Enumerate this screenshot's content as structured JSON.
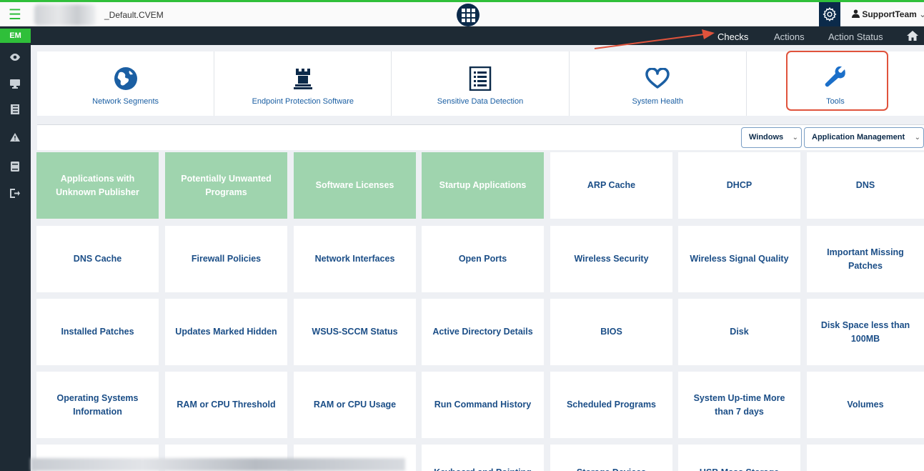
{
  "header": {
    "env_name": "_Default.CVEM",
    "user": "SupportTeam"
  },
  "sidebar": {
    "badge": "EM",
    "icons": [
      "eye-icon",
      "monitor-icon",
      "list-icon",
      "warning-icon",
      "book-icon",
      "logout-icon"
    ]
  },
  "nav": {
    "links": [
      "Checks",
      "Actions",
      "Action Status"
    ],
    "active": "Checks"
  },
  "categories": [
    {
      "label": "Network Segments",
      "icon": "globe-icon"
    },
    {
      "label": "Endpoint Protection Software",
      "icon": "rook-icon"
    },
    {
      "label": "Sensitive Data Detection",
      "icon": "document-list-icon"
    },
    {
      "label": "System Health",
      "icon": "heart-icon"
    },
    {
      "label": "Tools",
      "icon": "wrench-icon"
    }
  ],
  "filters": {
    "os": "Windows",
    "group": "Application Management"
  },
  "tiles": [
    "Applications with Unknown Publisher",
    "Potentially Unwanted Programs",
    "Software Licenses",
    "Startup Applications",
    "ARP Cache",
    "DHCP",
    "DNS",
    "DNS Cache",
    "Firewall Policies",
    "Network Interfaces",
    "Open Ports",
    "Wireless Security",
    "Wireless Signal Quality",
    "Important Missing Patches",
    "Installed Patches",
    "Updates Marked Hidden",
    "WSUS-SCCM Status",
    "Active Directory Details",
    "BIOS",
    "Disk",
    "Disk Space less than 100MB",
    "Operating Systems Information",
    "RAM or CPU Threshold",
    "RAM or CPU Usage",
    "Run Command History",
    "Scheduled Programs",
    "System Up-time More than 7 days",
    "Volumes",
    "",
    "",
    "",
    "Keyboard and Pointing",
    "Storage Devices",
    "USB Mass Storage",
    ""
  ],
  "colors": {
    "accent_green": "#2fbf3a",
    "navy": "#0b2a4a",
    "tile_green": "#9fd4ae",
    "link_blue": "#1b5fa3",
    "highlight_red": "#e0533c"
  }
}
